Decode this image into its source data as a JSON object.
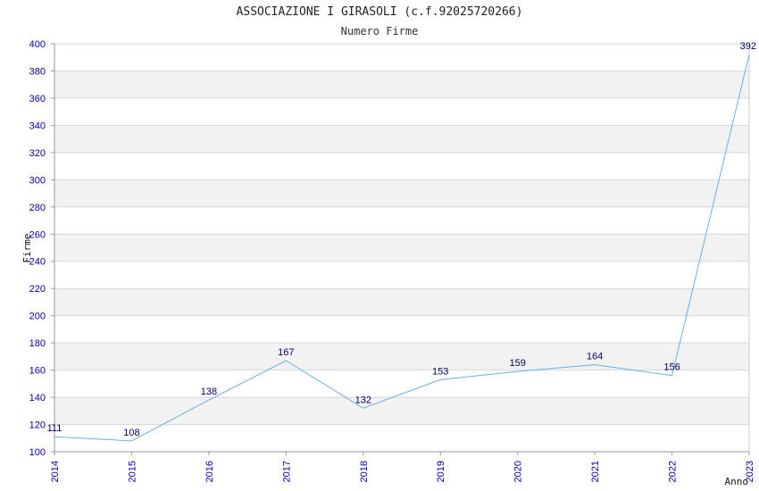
{
  "chart_data": {
    "type": "line",
    "title": "ASSOCIAZIONE I GIRASOLI (c.f.92025720266)",
    "subtitle": "Numero Firme",
    "xlabel": "Anno",
    "ylabel": "Firme",
    "x": [
      "2014",
      "2015",
      "2016",
      "2017",
      "2018",
      "2019",
      "2020",
      "2021",
      "2022",
      "2023"
    ],
    "values": [
      111,
      108,
      138,
      167,
      132,
      153,
      159,
      164,
      156,
      392
    ],
    "ylim": [
      100,
      400
    ],
    "yticks": [
      100,
      120,
      140,
      160,
      180,
      200,
      220,
      240,
      260,
      280,
      300,
      320,
      340,
      360,
      380,
      400
    ],
    "grid": true,
    "colors": {
      "line": "#6aaee8",
      "band": "#f2f2f2",
      "grid": "#d8d8d8",
      "tick": "#0000aa",
      "label": "#000066"
    }
  }
}
